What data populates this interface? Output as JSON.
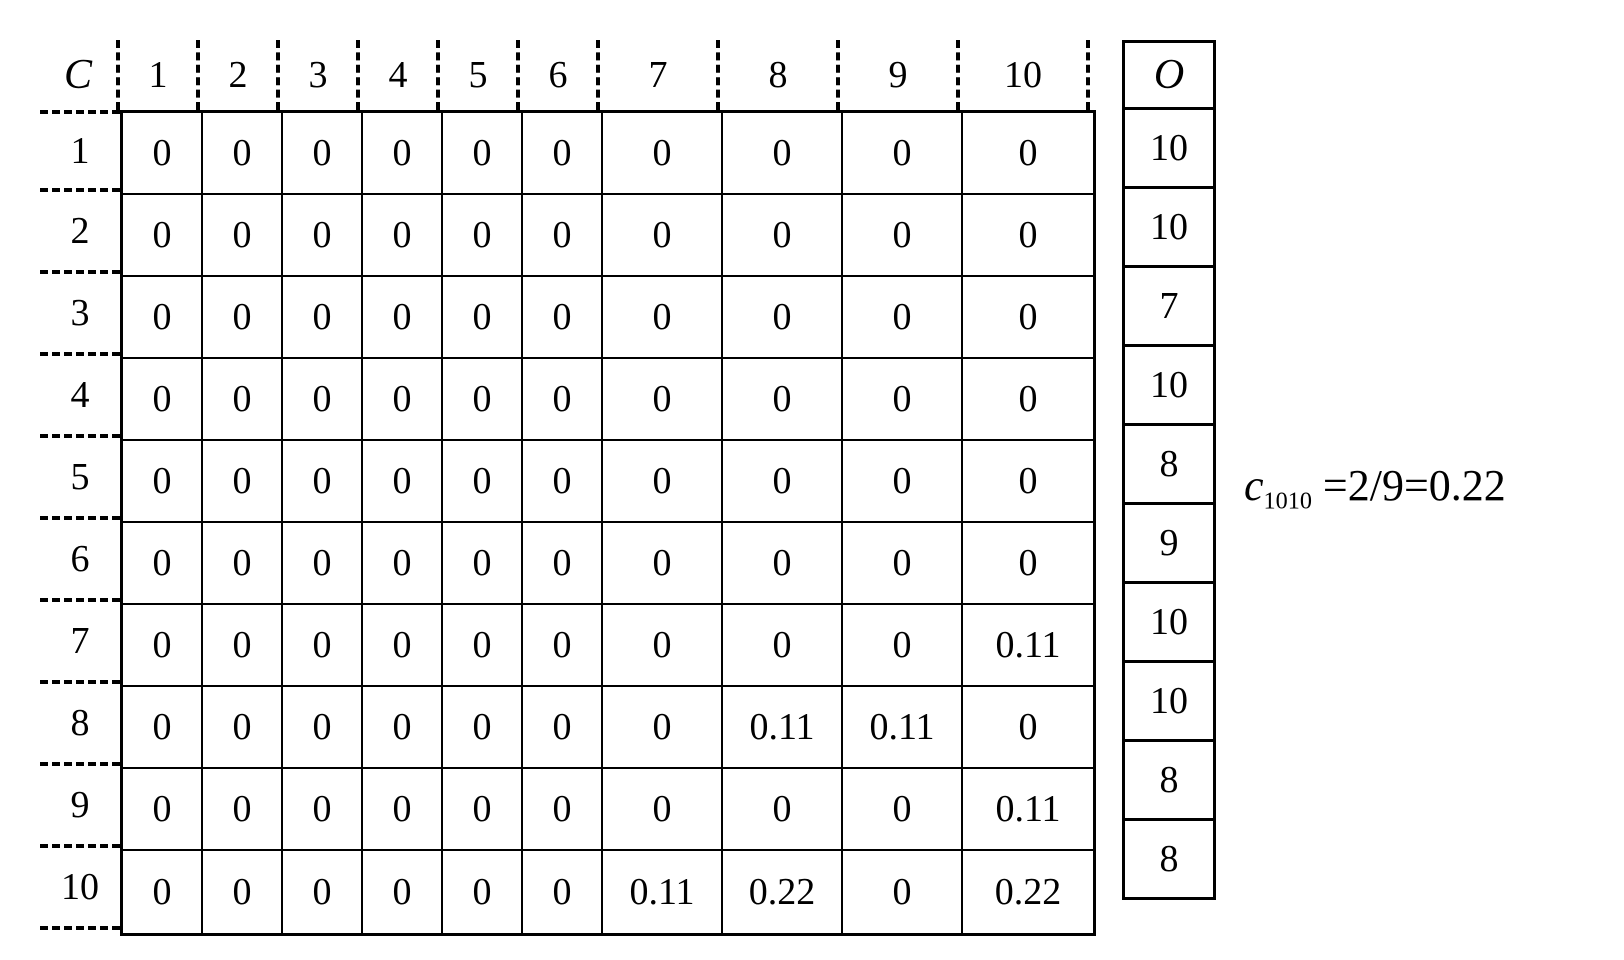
{
  "matrix": {
    "corner_label": "C",
    "col_headers": [
      "1",
      "2",
      "3",
      "4",
      "5",
      "6",
      "7",
      "8",
      "9",
      "10"
    ],
    "row_headers": [
      "1",
      "2",
      "3",
      "4",
      "5",
      "6",
      "7",
      "8",
      "9",
      "10"
    ],
    "cells": [
      [
        "0",
        "0",
        "0",
        "0",
        "0",
        "0",
        "0",
        "0",
        "0",
        "0"
      ],
      [
        "0",
        "0",
        "0",
        "0",
        "0",
        "0",
        "0",
        "0",
        "0",
        "0"
      ],
      [
        "0",
        "0",
        "0",
        "0",
        "0",
        "0",
        "0",
        "0",
        "0",
        "0"
      ],
      [
        "0",
        "0",
        "0",
        "0",
        "0",
        "0",
        "0",
        "0",
        "0",
        "0"
      ],
      [
        "0",
        "0",
        "0",
        "0",
        "0",
        "0",
        "0",
        "0",
        "0",
        "0"
      ],
      [
        "0",
        "0",
        "0",
        "0",
        "0",
        "0",
        "0",
        "0",
        "0",
        "0"
      ],
      [
        "0",
        "0",
        "0",
        "0",
        "0",
        "0",
        "0",
        "0",
        "0",
        "0.11"
      ],
      [
        "0",
        "0",
        "0",
        "0",
        "0",
        "0",
        "0",
        "0.11",
        "0.11",
        "0"
      ],
      [
        "0",
        "0",
        "0",
        "0",
        "0",
        "0",
        "0",
        "0",
        "0",
        "0.11"
      ],
      [
        "0",
        "0",
        "0",
        "0",
        "0",
        "0",
        "0.11",
        "0.22",
        "0",
        "0.22"
      ]
    ]
  },
  "o_column": {
    "label": "O",
    "values": [
      "10",
      "10",
      "7",
      "10",
      "8",
      "9",
      "10",
      "10",
      "8",
      "8"
    ]
  },
  "annotation": {
    "var": "c",
    "sub": "1010",
    "frac": "2/9",
    "approx": "0.22"
  },
  "chart_data": {
    "type": "table",
    "title": "",
    "corner": "C",
    "columns": [
      "1",
      "2",
      "3",
      "4",
      "5",
      "6",
      "7",
      "8",
      "9",
      "10"
    ],
    "rows": [
      "1",
      "2",
      "3",
      "4",
      "5",
      "6",
      "7",
      "8",
      "9",
      "10"
    ],
    "values": [
      [
        0,
        0,
        0,
        0,
        0,
        0,
        0,
        0,
        0,
        0
      ],
      [
        0,
        0,
        0,
        0,
        0,
        0,
        0,
        0,
        0,
        0
      ],
      [
        0,
        0,
        0,
        0,
        0,
        0,
        0,
        0,
        0,
        0
      ],
      [
        0,
        0,
        0,
        0,
        0,
        0,
        0,
        0,
        0,
        0
      ],
      [
        0,
        0,
        0,
        0,
        0,
        0,
        0,
        0,
        0,
        0
      ],
      [
        0,
        0,
        0,
        0,
        0,
        0,
        0,
        0,
        0,
        0
      ],
      [
        0,
        0,
        0,
        0,
        0,
        0,
        0,
        0,
        0,
        0.11
      ],
      [
        0,
        0,
        0,
        0,
        0,
        0,
        0,
        0.11,
        0.11,
        0
      ],
      [
        0,
        0,
        0,
        0,
        0,
        0,
        0,
        0,
        0,
        0.11
      ],
      [
        0,
        0,
        0,
        0,
        0,
        0,
        0.11,
        0.22,
        0,
        0.22
      ]
    ],
    "aux_column": {
      "name": "O",
      "values": [
        10,
        10,
        7,
        10,
        8,
        9,
        10,
        10,
        8,
        8
      ]
    },
    "annotation": "c_{1010} = 2/9 = 0.22"
  }
}
